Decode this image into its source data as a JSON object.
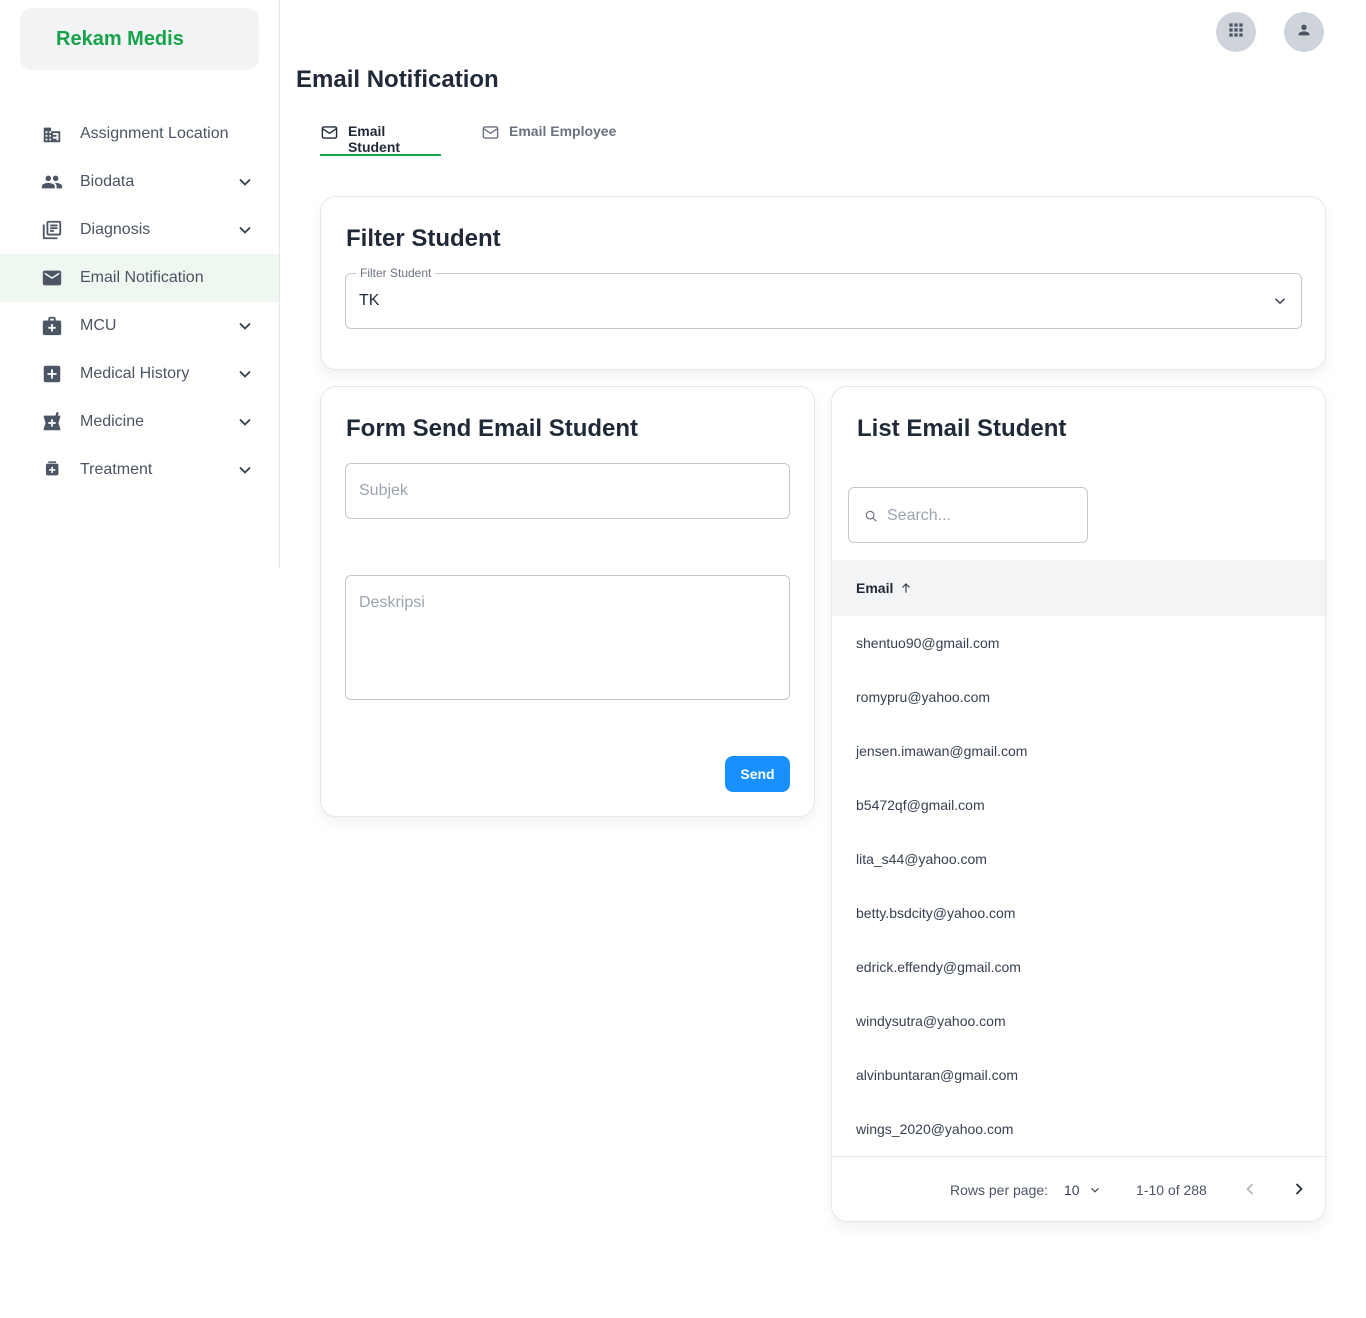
{
  "sidebar": {
    "brand": "Rekam Medis",
    "items": [
      {
        "label": "Assignment Location",
        "icon": "building-icon",
        "has_chevron": false,
        "active": false
      },
      {
        "label": "Biodata",
        "icon": "people-icon",
        "has_chevron": true,
        "active": false
      },
      {
        "label": "Diagnosis",
        "icon": "document-list-icon",
        "has_chevron": true,
        "active": false
      },
      {
        "label": "Email Notification",
        "icon": "mail-icon",
        "has_chevron": false,
        "active": true
      },
      {
        "label": "MCU",
        "icon": "medical-bag-icon",
        "has_chevron": true,
        "active": false
      },
      {
        "label": "Medical History",
        "icon": "medical-cross-icon",
        "has_chevron": true,
        "active": false
      },
      {
        "label": "Medicine",
        "icon": "medicine-icon",
        "has_chevron": true,
        "active": false
      },
      {
        "label": "Treatment",
        "icon": "medication-icon",
        "has_chevron": true,
        "active": false
      }
    ]
  },
  "header": {
    "apps_icon": "grid-apps-icon",
    "user_icon": "user-icon"
  },
  "page": {
    "title": "Email Notification",
    "tabs": [
      {
        "label": "Email Student",
        "icon": "envelope-icon",
        "active": true
      },
      {
        "label": "Email Employee",
        "icon": "envelope-icon",
        "active": false
      }
    ]
  },
  "filter": {
    "title": "Filter Student",
    "field_label": "Filter Student",
    "value": "TK"
  },
  "form": {
    "title": "Form Send Email Student",
    "subject_placeholder": "Subjek",
    "description_placeholder": "Deskripsi",
    "send_label": "Send"
  },
  "list": {
    "title": "List Email Student",
    "search_placeholder": "Search...",
    "column_header": "Email",
    "rows": [
      "shentuo90@gmail.com",
      "romypru@yahoo.com",
      "jensen.imawan@gmail.com",
      "b5472qf@gmail.com",
      "lita_s44@yahoo.com",
      "betty.bsdcity@yahoo.com",
      "edrick.effendy@gmail.com",
      "windysutra@yahoo.com",
      "alvinbuntaran@gmail.com",
      "wings_2020@yahoo.com"
    ],
    "rows_per_page_label": "Rows per page:",
    "rows_per_page_value": "10",
    "range": "1-10 of 288"
  },
  "colors": {
    "brand": "#16a34a",
    "active_nav_bg": "#eef8f0",
    "primary_button": "#1890ff"
  }
}
